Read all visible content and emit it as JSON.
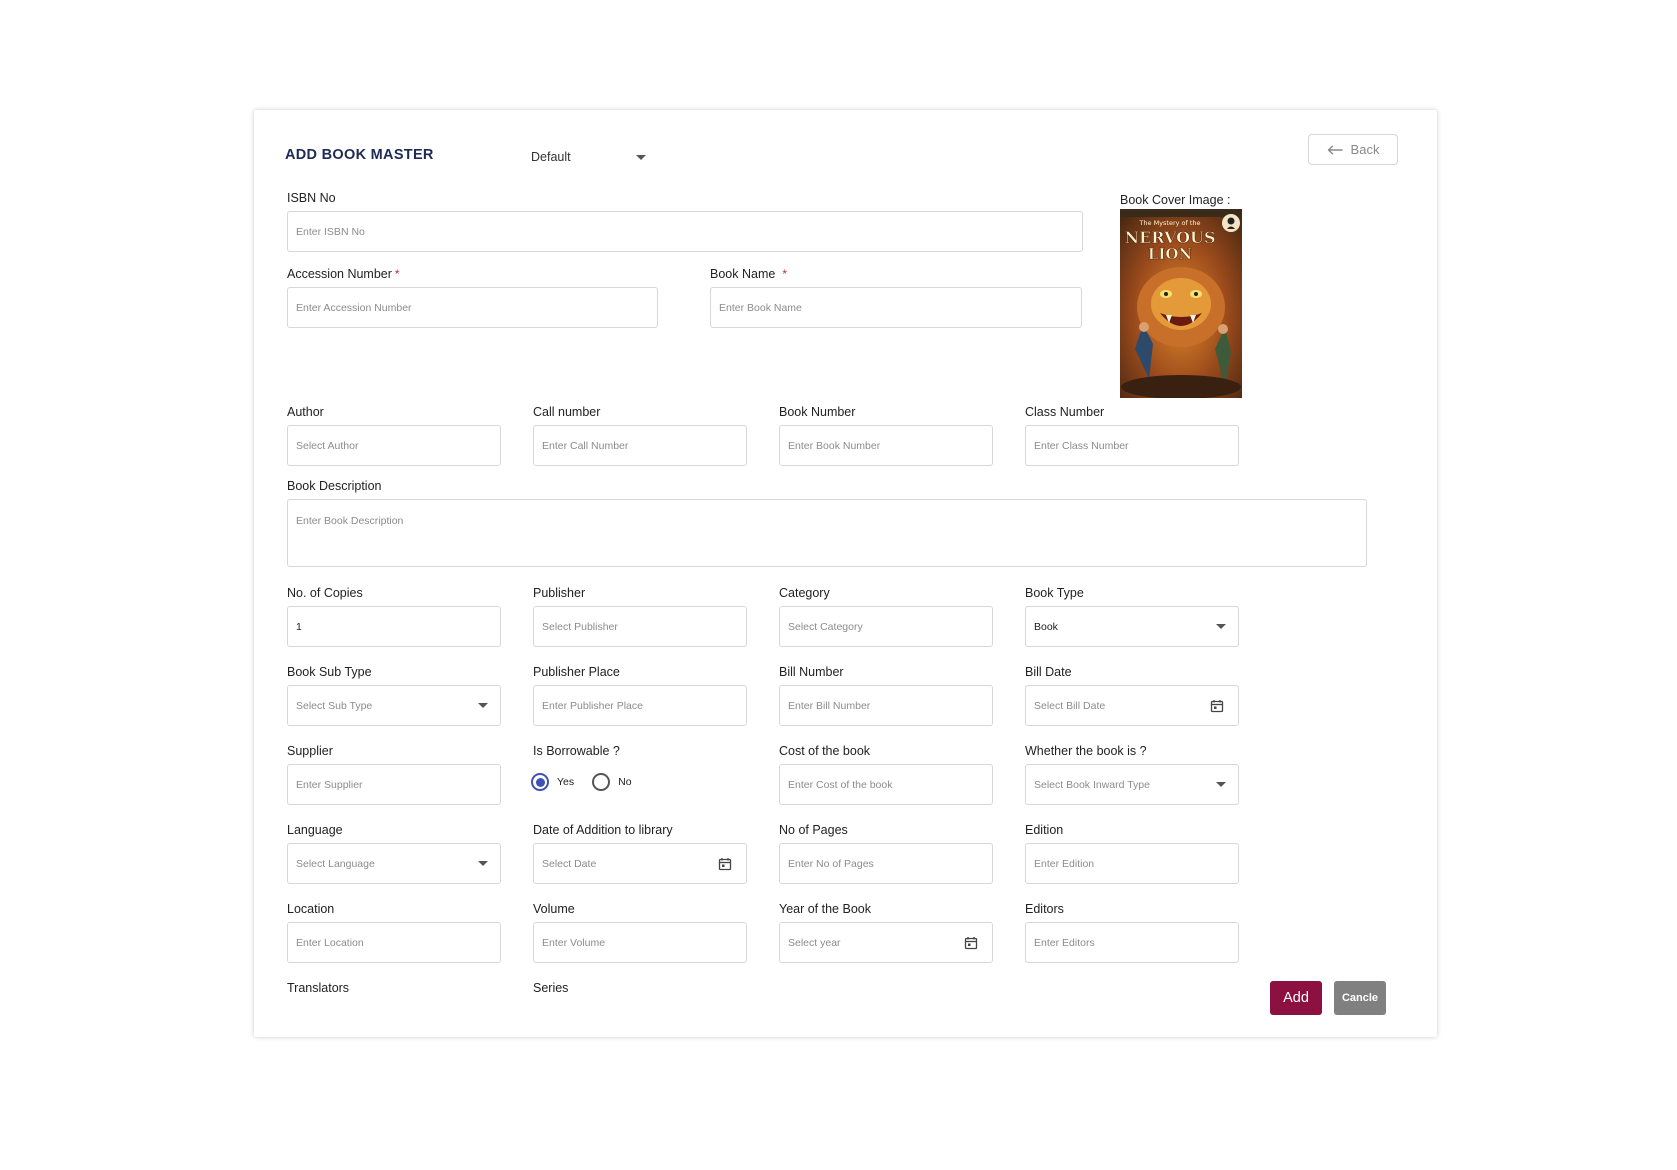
{
  "header": {
    "title": "ADD BOOK MASTER",
    "template_select": "Default",
    "back_label": "Back"
  },
  "cover": {
    "label": "Book Cover Image :",
    "image_title_top": "The Mystery of the",
    "image_title_main1": "NERVOUS",
    "image_title_main2": "LION"
  },
  "fields": {
    "isbn": {
      "label": "ISBN No",
      "placeholder": "Enter ISBN No"
    },
    "accession": {
      "label": "Accession Number",
      "placeholder": "Enter Accession Number",
      "required_mark": "*"
    },
    "book_name": {
      "label": "Book Name",
      "placeholder": "Enter Book Name",
      "required_mark": "*"
    },
    "author": {
      "label": "Author",
      "placeholder": "Select Author"
    },
    "call_number": {
      "label": "Call number",
      "placeholder": "Enter Call Number"
    },
    "book_number": {
      "label": "Book Number",
      "placeholder": "Enter Book Number"
    },
    "class_number": {
      "label": "Class Number",
      "placeholder": "Enter Class Number"
    },
    "description": {
      "label": "Book Description",
      "placeholder": "Enter Book Description"
    },
    "copies": {
      "label": "No. of Copies",
      "value": "1"
    },
    "publisher": {
      "label": "Publisher",
      "placeholder": "Select Publisher"
    },
    "category": {
      "label": "Category",
      "placeholder": "Select Category"
    },
    "book_type": {
      "label": "Book Type",
      "value": "Book"
    },
    "sub_type": {
      "label": "Book Sub Type",
      "placeholder": "Select Sub Type"
    },
    "publisher_place": {
      "label": "Publisher Place",
      "placeholder": "Enter Publisher Place"
    },
    "bill_number": {
      "label": "Bill Number",
      "placeholder": "Enter Bill Number"
    },
    "bill_date": {
      "label": "Bill Date",
      "placeholder": "Select Bill Date"
    },
    "supplier": {
      "label": "Supplier",
      "placeholder": "Enter Supplier"
    },
    "borrowable": {
      "label": "Is Borrowable ?",
      "options": [
        "Yes",
        "No"
      ],
      "selected": "Yes"
    },
    "cost": {
      "label": "Cost of the book",
      "placeholder": "Enter Cost of the book"
    },
    "inward_type": {
      "label": "Whether the book is ?",
      "placeholder": "Select Book Inward Type"
    },
    "language": {
      "label": "Language",
      "placeholder": "Select Language"
    },
    "date_addition": {
      "label": "Date of Addition to library",
      "placeholder": "Select Date"
    },
    "pages": {
      "label": "No of Pages",
      "placeholder": "Enter No of Pages"
    },
    "edition": {
      "label": "Edition",
      "placeholder": "Enter Edition"
    },
    "location": {
      "label": "Location",
      "placeholder": "Enter Location"
    },
    "volume": {
      "label": "Volume",
      "placeholder": "Enter Volume"
    },
    "year": {
      "label": "Year of the Book",
      "placeholder": "Select year"
    },
    "editors": {
      "label": "Editors",
      "placeholder": "Enter Editors"
    },
    "translators": {
      "label": "Translators"
    },
    "series": {
      "label": "Series"
    }
  },
  "actions": {
    "add_label": "Add",
    "cancel_label": "Cancle"
  },
  "colors": {
    "title": "#1e2a55",
    "add_button": "#8c1040",
    "cancel_button": "#808080",
    "radio_selected": "#3f51b5",
    "required": "#c0312b"
  }
}
